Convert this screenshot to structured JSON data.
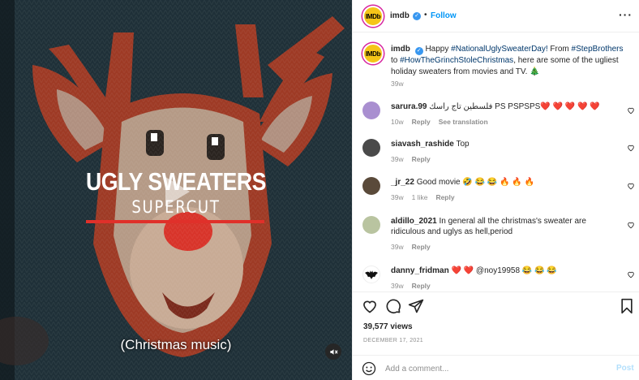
{
  "video": {
    "title_line1": "UGLY SWEATERS",
    "title_line2": "SUPERCUT",
    "caption": "(Christmas music)"
  },
  "header": {
    "username": "imdb",
    "separator": "•",
    "follow_label": "Follow",
    "more_label": "···",
    "avatar_text": "IMDb"
  },
  "post": {
    "username": "imdb",
    "caption_prefix": " Happy ",
    "hashtag1": "#NationalUglySweaterDay!",
    "caption_mid1": " From ",
    "hashtag2": "#StepBrothers",
    "caption_mid2": " to ",
    "hashtag3": "#HowTheGrinchStoleChristmas",
    "caption_suffix": ", here are some of the ugliest holiday sweaters from movies and TV. 🎄",
    "time": "39w"
  },
  "comments": [
    {
      "username": "sarura.99",
      "text": "فلسطين تاج راسك PS PSPSPS❤️ ❤️ ❤️ ❤️ ❤️",
      "time": "10w",
      "likes": "",
      "reply": "Reply",
      "extra": "See translation",
      "avatar_color": "#a98fd0"
    },
    {
      "username": "siavash_rashide",
      "text": "Top",
      "time": "39w",
      "likes": "",
      "reply": "Reply",
      "extra": "",
      "avatar_color": "#4a4a4a"
    },
    {
      "username": "_jr_22",
      "text": "Good movie 🤣 😂 😂 🔥 🔥 🔥",
      "time": "39w",
      "likes": "1 like",
      "reply": "Reply",
      "extra": "",
      "avatar_color": "#5a4a3a"
    },
    {
      "username": "aldillo_2021",
      "text": "In general all the christmas's sweater are ridiculous and uglys as hell,period",
      "time": "39w",
      "likes": "",
      "reply": "Reply",
      "extra": "",
      "avatar_color": "#b9c4a0"
    },
    {
      "username": "danny_fridman",
      "text": "❤️ ❤️ @noy19958 😂 😂 😂",
      "time": "39w",
      "likes": "",
      "reply": "Reply",
      "extra": "",
      "avatar_color": "#222222"
    }
  ],
  "stats": {
    "views": "39,577 views",
    "date": "DECEMBER 17, 2021"
  },
  "add_comment": {
    "placeholder": "Add a comment...",
    "post_label": "Post"
  },
  "colors": {
    "link": "#00376b",
    "follow": "#0095f6",
    "imdb_yellow": "#f5c518",
    "muted": "#8e8e8e"
  }
}
